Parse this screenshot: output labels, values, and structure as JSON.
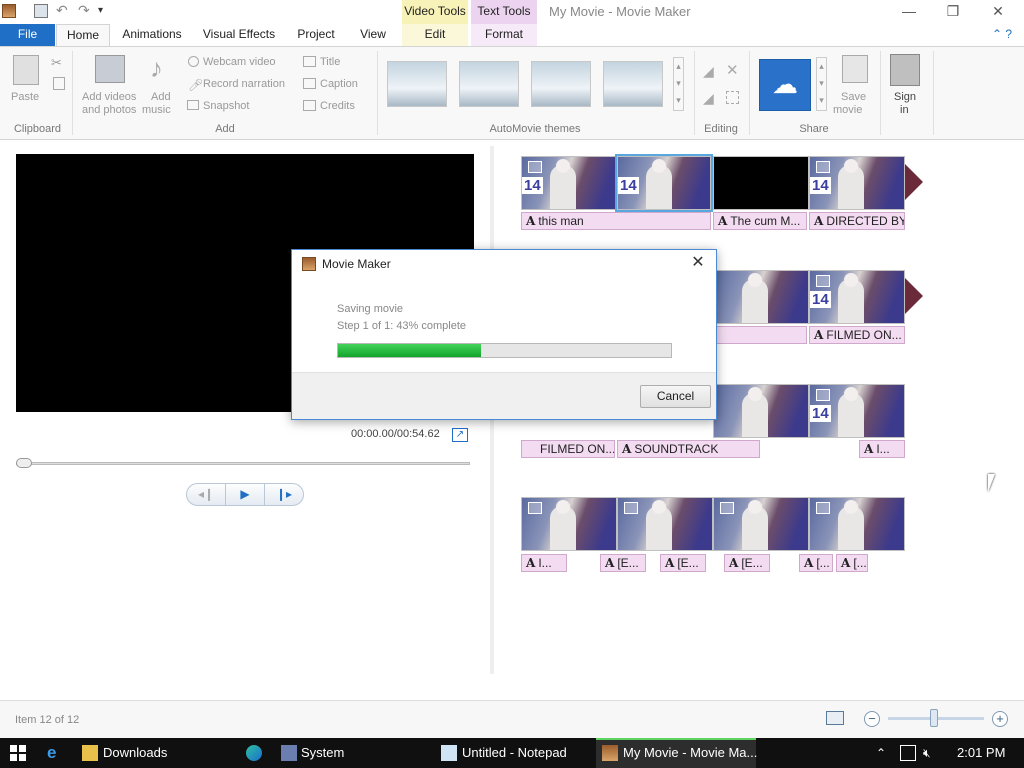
{
  "window": {
    "title": "My Movie - Movie Maker",
    "context_tabs": {
      "video_tools": "Video Tools",
      "text_tools": "Text Tools"
    },
    "controls": {
      "minimize": "—",
      "restore": "❐",
      "close": "✕"
    }
  },
  "ribbon_tabs": {
    "file": "File",
    "home": "Home",
    "animations": "Animations",
    "visual_effects": "Visual Effects",
    "project": "Project",
    "view": "View",
    "edit": "Edit",
    "format": "Format"
  },
  "ribbon": {
    "clipboard": {
      "label": "Clipboard",
      "paste": "Paste"
    },
    "add": {
      "label": "Add",
      "add_videos": "Add videos",
      "add_videos_2": "and photos",
      "add_music": "Add",
      "add_music_2": "music",
      "webcam": "Webcam video",
      "record": "Record narration",
      "snapshot": "Snapshot",
      "title": "Title",
      "caption": "Caption",
      "credits": "Credits"
    },
    "themes": {
      "label": "AutoMovie themes"
    },
    "editing": {
      "label": "Editing"
    },
    "share": {
      "label": "Share",
      "save_movie": "Save",
      "save_movie_2": "movie"
    },
    "sign_in": {
      "label": "Sign",
      "label_2": "in"
    }
  },
  "preview": {
    "time": "00:00.00/00:54.62"
  },
  "storyboard": {
    "row1": [
      "this man",
      "The cum M...",
      "DIRECTED BY"
    ],
    "row2": [
      "FILMED ON..."
    ],
    "row3": [
      "FILMED ON...",
      "SOUNDTRACK",
      "I..."
    ],
    "row4": [
      "I...",
      "[E...",
      "[E...",
      "[E...",
      "[...",
      "[..."
    ],
    "jersey_number": "14"
  },
  "dialog": {
    "title": "Movie Maker",
    "status": "Saving movie",
    "step": "Step 1 of 1: 43% complete",
    "progress": 0.43,
    "cancel": "Cancel",
    "close": "✕"
  },
  "statusbar": {
    "item": "Item 12 of 12",
    "zoom_out": "−",
    "zoom_in": "+"
  },
  "taskbar": {
    "downloads": "Downloads",
    "system": "System",
    "notepad": "Untitled - Notepad",
    "moviemaker": "My Movie - Movie Ma...",
    "time": "2:01 PM"
  },
  "colors": {
    "file_tab": "#1f6fc7",
    "video_tools": "#f7f2b8",
    "text_tools": "#ecd3f0",
    "progress": "#13a52b"
  }
}
